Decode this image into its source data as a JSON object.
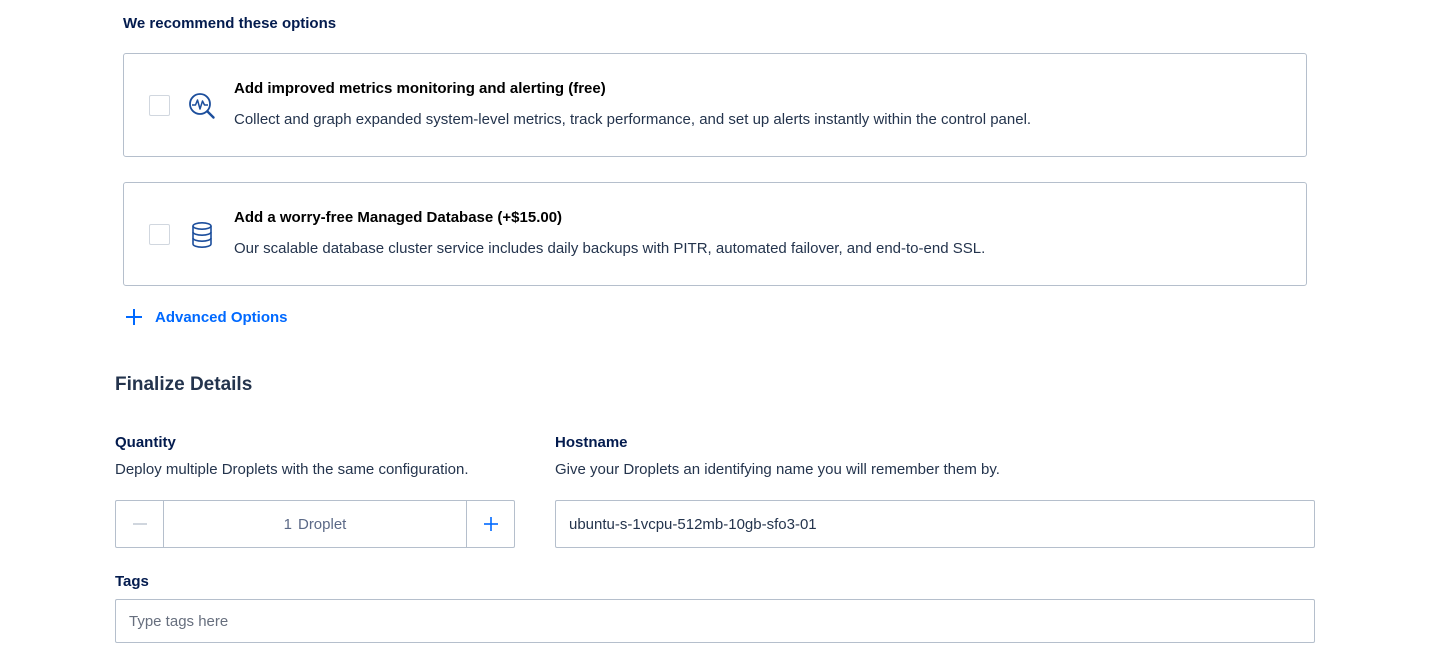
{
  "recommendations": {
    "heading": "We recommend these options",
    "options": [
      {
        "title": "Add improved metrics monitoring and alerting (free)",
        "description": "Collect and graph expanded system-level metrics, track performance, and set up alerts instantly within the control panel.",
        "icon": "metrics-magnifier-icon",
        "checked": false
      },
      {
        "title": "Add a worry-free Managed Database (+$15.00)",
        "description": "Our scalable database cluster service includes daily backups with PITR, automated failover, and end-to-end SSL.",
        "icon": "database-icon",
        "checked": false
      }
    ]
  },
  "advanced": {
    "label": "Advanced Options",
    "icon": "plus-icon"
  },
  "finalize": {
    "title": "Finalize Details",
    "quantity": {
      "label": "Quantity",
      "help": "Deploy multiple Droplets with the same configuration.",
      "value": "1",
      "unit": "Droplet"
    },
    "hostname": {
      "label": "Hostname",
      "help": "Give your Droplets an identifying name you will remember them by.",
      "value": "ubuntu-s-1vcpu-512mb-10gb-sfo3-01"
    },
    "tags": {
      "label": "Tags",
      "placeholder": "Type tags here"
    }
  },
  "colors": {
    "accent": "#0069ff",
    "heading": "#031b4e",
    "border": "#b5bfcc"
  }
}
